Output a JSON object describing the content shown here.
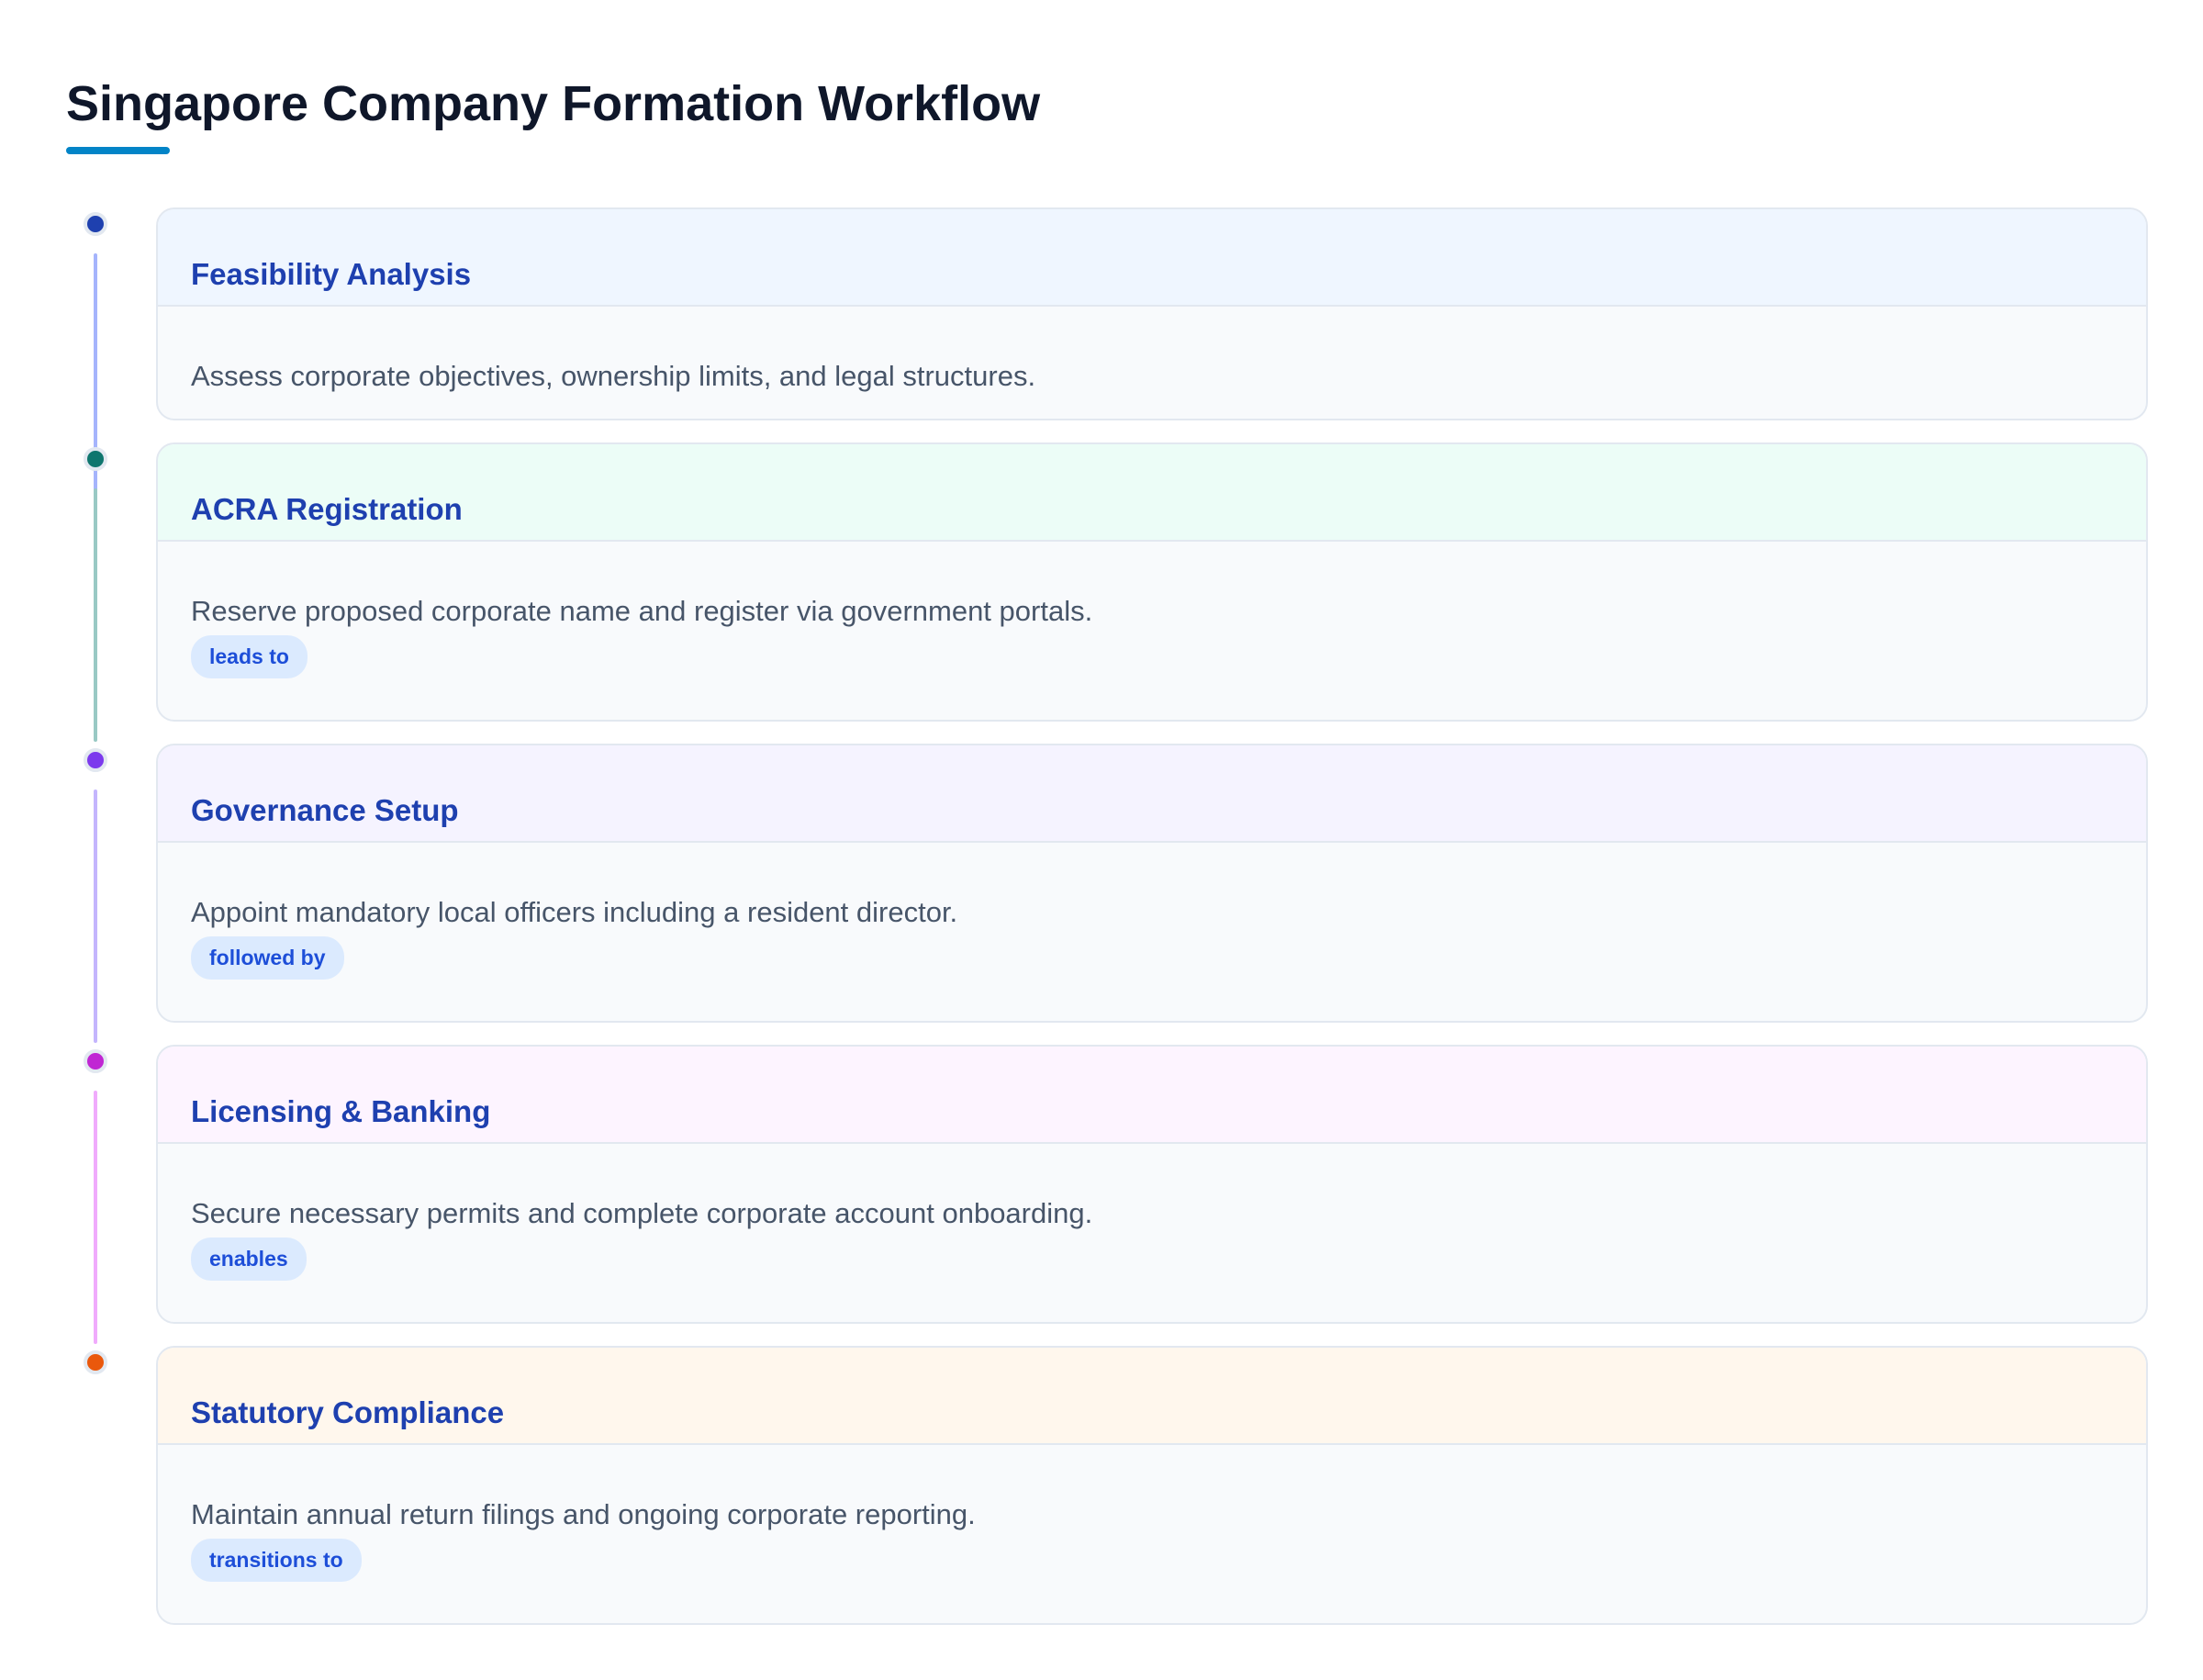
{
  "page": {
    "title": "Singapore Company Formation Workflow"
  },
  "steps": [
    {
      "title": "Feasibility Analysis",
      "description": "Assess corporate objectives, ownership limits, and legal structures.",
      "badge": "",
      "accent": "#1e40af",
      "line_color": "#a5b4fc",
      "head_bg": "#eff6ff"
    },
    {
      "title": "ACRA Registration",
      "description": "Reserve proposed corporate name and register via government portals.",
      "badge": "leads to",
      "accent": "#0f766e",
      "line_color": "#99c9c4",
      "head_bg": "#ecfdf7"
    },
    {
      "title": "Governance Setup",
      "description": "Appoint mandatory local officers including a resident director.",
      "badge": "followed by",
      "accent": "#7c3aed",
      "line_color": "#c4b5fd",
      "head_bg": "#f5f3ff"
    },
    {
      "title": "Licensing & Banking",
      "description": "Secure necessary permits and complete corporate account onboarding.",
      "badge": "enables",
      "accent": "#c026d3",
      "line_color": "#f0abfc",
      "head_bg": "#fdf4ff"
    },
    {
      "title": "Statutory Compliance",
      "description": "Maintain annual return filings and ongoing corporate reporting.",
      "badge": "transitions to",
      "accent": "#ea580c",
      "line_color": "",
      "head_bg": "#fff7ed"
    }
  ]
}
